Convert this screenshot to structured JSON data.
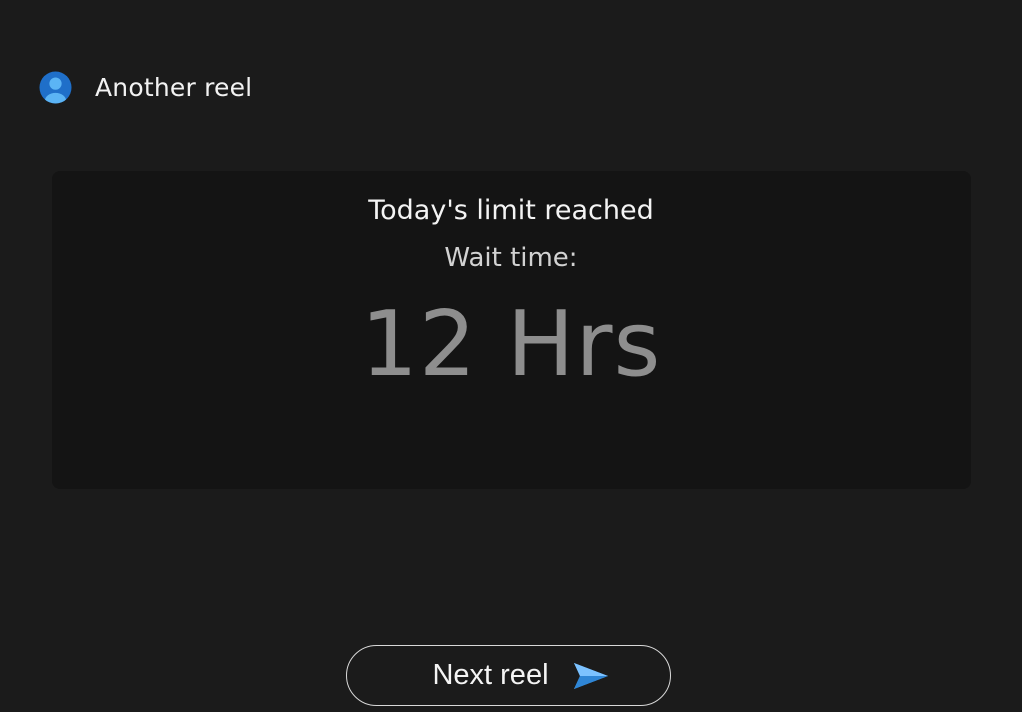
{
  "header": {
    "avatar_icon": "user-avatar-icon",
    "title": "Another reel"
  },
  "limit_card": {
    "title": "Today's limit reached",
    "wait_label": "Wait time:",
    "wait_value": "12 Hrs"
  },
  "footer": {
    "next_label": "Next reel",
    "next_icon": "send-arrow-icon"
  },
  "colors": {
    "background": "#1b1b1b",
    "card": "#141414",
    "accent": "#4aa3f0"
  }
}
